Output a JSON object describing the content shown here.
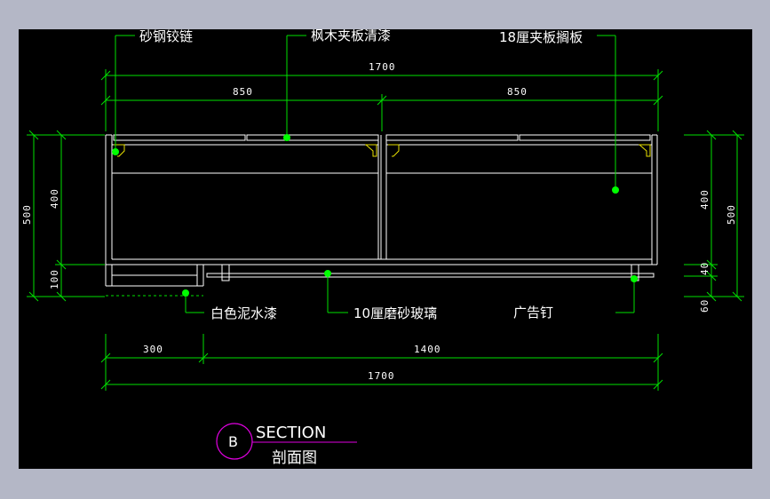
{
  "callouts": {
    "hinge": "砂钢铰链",
    "maple_board": "枫木夹板清漆",
    "shelf_board": "18厘夹板搁板",
    "white_cement": "白色泥水漆",
    "frosted_glass": "10厘磨砂玻璃",
    "ad_nail": "广告钉"
  },
  "dimensions": {
    "top_total": "1700",
    "top_left": "850",
    "top_right": "850",
    "left_outer": "500",
    "left_upper": "400",
    "left_lower": "100",
    "right_upper": "400",
    "right_outer": "500",
    "right_mid": "40",
    "right_low": "60",
    "bottom_left": "300",
    "bottom_right": "1400",
    "bottom_total": "1700"
  },
  "title": {
    "marker": "B",
    "en": "SECTION",
    "cn": "剖面图"
  },
  "colors": {
    "background": "#000000",
    "frame": "#b4b7c6",
    "dimension": "#00e000",
    "leader_dot": "#00ff00",
    "outline": "#ffffff",
    "title_circle": "#e000e0"
  }
}
